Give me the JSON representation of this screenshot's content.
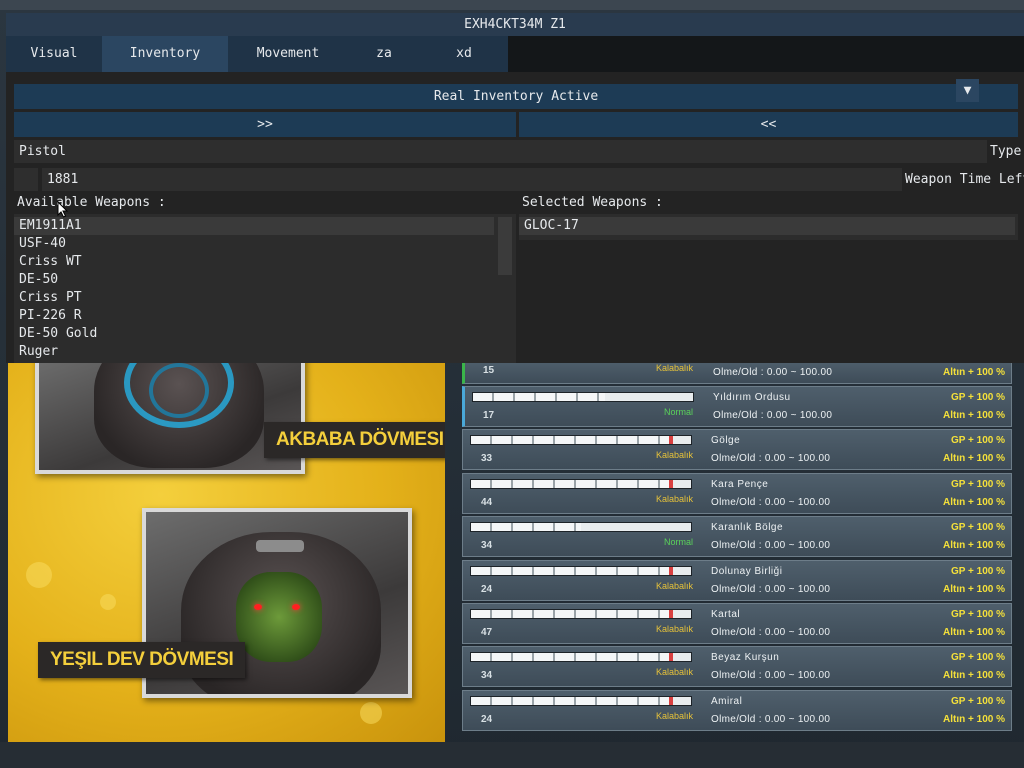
{
  "window": {
    "title": "EXH4CKT34M Z1"
  },
  "tabs": [
    {
      "label": "Visual",
      "active": false
    },
    {
      "label": "Inventory",
      "active": true
    },
    {
      "label": "Movement",
      "active": false
    },
    {
      "label": "za",
      "active": false
    },
    {
      "label": "xd",
      "active": false
    }
  ],
  "inventory": {
    "status_button": "Real Inventory Active",
    "add_button": ">>",
    "remove_button": "<<",
    "type_select": {
      "value": "Pistol",
      "label": "Type"
    },
    "time_field": {
      "value": "1881",
      "label": "Weapon Time Left"
    },
    "available_label": "Available Weapons :",
    "selected_label": "Selected Weapons :",
    "available_weapons": [
      "EM1911A1",
      "USF-40",
      "Criss WT",
      "DE-50",
      "Criss PT",
      "PI-226 R",
      "DE-50 Gold",
      "Ruger"
    ],
    "selected_weapons": [
      "GLOC-17"
    ]
  },
  "promo": {
    "label_top": "AKBABA DÖVMESI",
    "label_bottom": "YEŞIL DEV DÖVMESI",
    "brand_color": "#e4b11a"
  },
  "channels": [
    {
      "name": "",
      "count": "15",
      "fill": 0,
      "status": "Kalabalık",
      "status_type": "crowded",
      "death": "Olme/Old : 0.00 ~ 100.00",
      "gp": "",
      "gold": "Altın + 100 %",
      "marker": "green"
    },
    {
      "name": "Yıldırım Ordusu",
      "count": "17",
      "fill": 0.6,
      "status": "Normal",
      "status_type": "normal",
      "death": "Olme/Old : 0.00 ~ 100.00",
      "gp": "GP + 100 %",
      "gold": "Altın + 100 %",
      "marker": "blue"
    },
    {
      "name": "Gölge",
      "count": "33",
      "fill": 0.9,
      "status": "Kalabalık",
      "status_type": "crowded",
      "death": "Olme/Old : 0.00 ~ 100.00",
      "gp": "GP + 100 %",
      "gold": "Altın + 100 %",
      "marker": ""
    },
    {
      "name": "Kara Pençe",
      "count": "44",
      "fill": 0.9,
      "status": "Kalabalık",
      "status_type": "crowded",
      "death": "Olme/Old : 0.00 ~ 100.00",
      "gp": "GP + 100 %",
      "gold": "Altın + 100 %",
      "marker": ""
    },
    {
      "name": "Karanlık Bölge",
      "count": "34",
      "fill": 0.5,
      "status": "Normal",
      "status_type": "normal",
      "death": "Olme/Old : 0.00 ~ 100.00",
      "gp": "GP + 100 %",
      "gold": "Altın + 100 %",
      "marker": ""
    },
    {
      "name": "Dolunay Birliği",
      "count": "24",
      "fill": 0.9,
      "status": "Kalabalık",
      "status_type": "crowded",
      "death": "Olme/Old : 0.00 ~ 100.00",
      "gp": "GP + 100 %",
      "gold": "Altın + 100 %",
      "marker": ""
    },
    {
      "name": "Kartal",
      "count": "47",
      "fill": 0.9,
      "status": "Kalabalık",
      "status_type": "crowded",
      "death": "Olme/Old : 0.00 ~ 100.00",
      "gp": "GP + 100 %",
      "gold": "Altın + 100 %",
      "marker": ""
    },
    {
      "name": "Beyaz Kurşun",
      "count": "34",
      "fill": 0.9,
      "status": "Kalabalık",
      "status_type": "crowded",
      "death": "Olme/Old : 0.00 ~ 100.00",
      "gp": "GP + 100 %",
      "gold": "Altın + 100 %",
      "marker": ""
    },
    {
      "name": "Amiral",
      "count": "24",
      "fill": 0.9,
      "status": "Kalabalık",
      "status_type": "crowded",
      "death": "Olme/Old : 0.00 ~ 100.00",
      "gp": "GP + 100 %",
      "gold": "Altın + 100 %",
      "marker": ""
    }
  ],
  "colors": {
    "menu_title_bg": "#293b4f",
    "tab_active_bg": "#2b4661",
    "button_bg": "#1d3b55",
    "status_crowded": "#e6c23a",
    "status_normal": "#5ad15a",
    "bonus": "#f4e03a"
  },
  "icons": {
    "dropdown": "triangle-down-icon",
    "cursor": "mouse-pointer-icon"
  }
}
